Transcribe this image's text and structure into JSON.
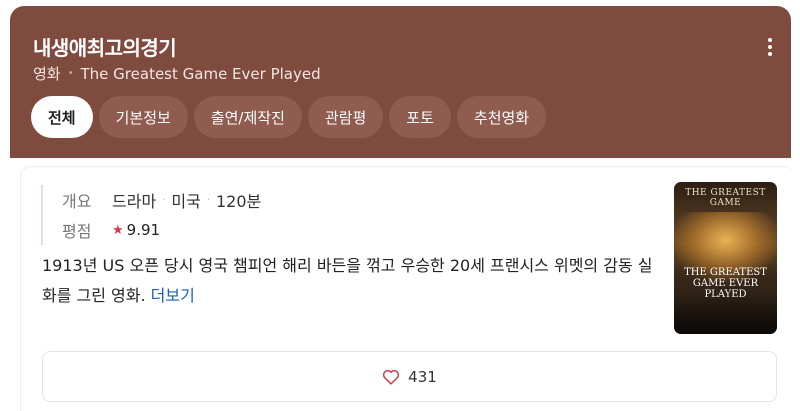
{
  "header": {
    "title": "내생애최고의경기",
    "category": "영화",
    "english_title": "The Greatest Game Ever Played",
    "background_color": "#7f4b3e"
  },
  "tabs": [
    {
      "label": "전체",
      "active": true
    },
    {
      "label": "기본정보",
      "active": false
    },
    {
      "label": "출연/제작진",
      "active": false
    },
    {
      "label": "관람평",
      "active": false
    },
    {
      "label": "포토",
      "active": false
    },
    {
      "label": "추천영화",
      "active": false
    }
  ],
  "info": {
    "overview_label": "개요",
    "genre": "드라마",
    "country": "미국",
    "runtime": "120분",
    "rating_label": "평점",
    "rating": "9.91"
  },
  "synopsis": {
    "text": "1913년 US 오픈 당시 영국 챔피언 해리 바든을 꺾고 우승한 20세 프랜시스 위멧의 감동 실화를 그린 영화.",
    "more_label": "더보기"
  },
  "poster": {
    "top_text": "THE GREATEST GAME",
    "title_text": "THE GREATEST GAME EVER PLAYED"
  },
  "like": {
    "icon": "heart-outline-icon",
    "count": "431"
  },
  "more_menu_icon": "vertical-dots-icon"
}
